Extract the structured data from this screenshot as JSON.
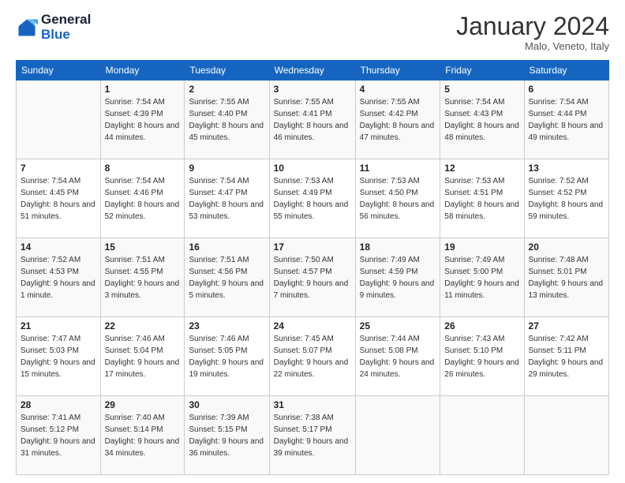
{
  "header": {
    "logo_line1": "General",
    "logo_line2": "Blue",
    "month": "January 2024",
    "location": "Malo, Veneto, Italy"
  },
  "weekdays": [
    "Sunday",
    "Monday",
    "Tuesday",
    "Wednesday",
    "Thursday",
    "Friday",
    "Saturday"
  ],
  "weeks": [
    [
      {
        "day": "",
        "sunrise": "",
        "sunset": "",
        "daylight": ""
      },
      {
        "day": "1",
        "sunrise": "Sunrise: 7:54 AM",
        "sunset": "Sunset: 4:39 PM",
        "daylight": "Daylight: 8 hours and 44 minutes."
      },
      {
        "day": "2",
        "sunrise": "Sunrise: 7:55 AM",
        "sunset": "Sunset: 4:40 PM",
        "daylight": "Daylight: 8 hours and 45 minutes."
      },
      {
        "day": "3",
        "sunrise": "Sunrise: 7:55 AM",
        "sunset": "Sunset: 4:41 PM",
        "daylight": "Daylight: 8 hours and 46 minutes."
      },
      {
        "day": "4",
        "sunrise": "Sunrise: 7:55 AM",
        "sunset": "Sunset: 4:42 PM",
        "daylight": "Daylight: 8 hours and 47 minutes."
      },
      {
        "day": "5",
        "sunrise": "Sunrise: 7:54 AM",
        "sunset": "Sunset: 4:43 PM",
        "daylight": "Daylight: 8 hours and 48 minutes."
      },
      {
        "day": "6",
        "sunrise": "Sunrise: 7:54 AM",
        "sunset": "Sunset: 4:44 PM",
        "daylight": "Daylight: 8 hours and 49 minutes."
      }
    ],
    [
      {
        "day": "7",
        "sunrise": "Sunrise: 7:54 AM",
        "sunset": "Sunset: 4:45 PM",
        "daylight": "Daylight: 8 hours and 51 minutes."
      },
      {
        "day": "8",
        "sunrise": "Sunrise: 7:54 AM",
        "sunset": "Sunset: 4:46 PM",
        "daylight": "Daylight: 8 hours and 52 minutes."
      },
      {
        "day": "9",
        "sunrise": "Sunrise: 7:54 AM",
        "sunset": "Sunset: 4:47 PM",
        "daylight": "Daylight: 8 hours and 53 minutes."
      },
      {
        "day": "10",
        "sunrise": "Sunrise: 7:53 AM",
        "sunset": "Sunset: 4:49 PM",
        "daylight": "Daylight: 8 hours and 55 minutes."
      },
      {
        "day": "11",
        "sunrise": "Sunrise: 7:53 AM",
        "sunset": "Sunset: 4:50 PM",
        "daylight": "Daylight: 8 hours and 56 minutes."
      },
      {
        "day": "12",
        "sunrise": "Sunrise: 7:53 AM",
        "sunset": "Sunset: 4:51 PM",
        "daylight": "Daylight: 8 hours and 58 minutes."
      },
      {
        "day": "13",
        "sunrise": "Sunrise: 7:52 AM",
        "sunset": "Sunset: 4:52 PM",
        "daylight": "Daylight: 8 hours and 59 minutes."
      }
    ],
    [
      {
        "day": "14",
        "sunrise": "Sunrise: 7:52 AM",
        "sunset": "Sunset: 4:53 PM",
        "daylight": "Daylight: 9 hours and 1 minute."
      },
      {
        "day": "15",
        "sunrise": "Sunrise: 7:51 AM",
        "sunset": "Sunset: 4:55 PM",
        "daylight": "Daylight: 9 hours and 3 minutes."
      },
      {
        "day": "16",
        "sunrise": "Sunrise: 7:51 AM",
        "sunset": "Sunset: 4:56 PM",
        "daylight": "Daylight: 9 hours and 5 minutes."
      },
      {
        "day": "17",
        "sunrise": "Sunrise: 7:50 AM",
        "sunset": "Sunset: 4:57 PM",
        "daylight": "Daylight: 9 hours and 7 minutes."
      },
      {
        "day": "18",
        "sunrise": "Sunrise: 7:49 AM",
        "sunset": "Sunset: 4:59 PM",
        "daylight": "Daylight: 9 hours and 9 minutes."
      },
      {
        "day": "19",
        "sunrise": "Sunrise: 7:49 AM",
        "sunset": "Sunset: 5:00 PM",
        "daylight": "Daylight: 9 hours and 11 minutes."
      },
      {
        "day": "20",
        "sunrise": "Sunrise: 7:48 AM",
        "sunset": "Sunset: 5:01 PM",
        "daylight": "Daylight: 9 hours and 13 minutes."
      }
    ],
    [
      {
        "day": "21",
        "sunrise": "Sunrise: 7:47 AM",
        "sunset": "Sunset: 5:03 PM",
        "daylight": "Daylight: 9 hours and 15 minutes."
      },
      {
        "day": "22",
        "sunrise": "Sunrise: 7:46 AM",
        "sunset": "Sunset: 5:04 PM",
        "daylight": "Daylight: 9 hours and 17 minutes."
      },
      {
        "day": "23",
        "sunrise": "Sunrise: 7:46 AM",
        "sunset": "Sunset: 5:05 PM",
        "daylight": "Daylight: 9 hours and 19 minutes."
      },
      {
        "day": "24",
        "sunrise": "Sunrise: 7:45 AM",
        "sunset": "Sunset: 5:07 PM",
        "daylight": "Daylight: 9 hours and 22 minutes."
      },
      {
        "day": "25",
        "sunrise": "Sunrise: 7:44 AM",
        "sunset": "Sunset: 5:08 PM",
        "daylight": "Daylight: 9 hours and 24 minutes."
      },
      {
        "day": "26",
        "sunrise": "Sunrise: 7:43 AM",
        "sunset": "Sunset: 5:10 PM",
        "daylight": "Daylight: 9 hours and 26 minutes."
      },
      {
        "day": "27",
        "sunrise": "Sunrise: 7:42 AM",
        "sunset": "Sunset: 5:11 PM",
        "daylight": "Daylight: 9 hours and 29 minutes."
      }
    ],
    [
      {
        "day": "28",
        "sunrise": "Sunrise: 7:41 AM",
        "sunset": "Sunset: 5:12 PM",
        "daylight": "Daylight: 9 hours and 31 minutes."
      },
      {
        "day": "29",
        "sunrise": "Sunrise: 7:40 AM",
        "sunset": "Sunset: 5:14 PM",
        "daylight": "Daylight: 9 hours and 34 minutes."
      },
      {
        "day": "30",
        "sunrise": "Sunrise: 7:39 AM",
        "sunset": "Sunset: 5:15 PM",
        "daylight": "Daylight: 9 hours and 36 minutes."
      },
      {
        "day": "31",
        "sunrise": "Sunrise: 7:38 AM",
        "sunset": "Sunset: 5:17 PM",
        "daylight": "Daylight: 9 hours and 39 minutes."
      },
      {
        "day": "",
        "sunrise": "",
        "sunset": "",
        "daylight": ""
      },
      {
        "day": "",
        "sunrise": "",
        "sunset": "",
        "daylight": ""
      },
      {
        "day": "",
        "sunrise": "",
        "sunset": "",
        "daylight": ""
      }
    ]
  ]
}
